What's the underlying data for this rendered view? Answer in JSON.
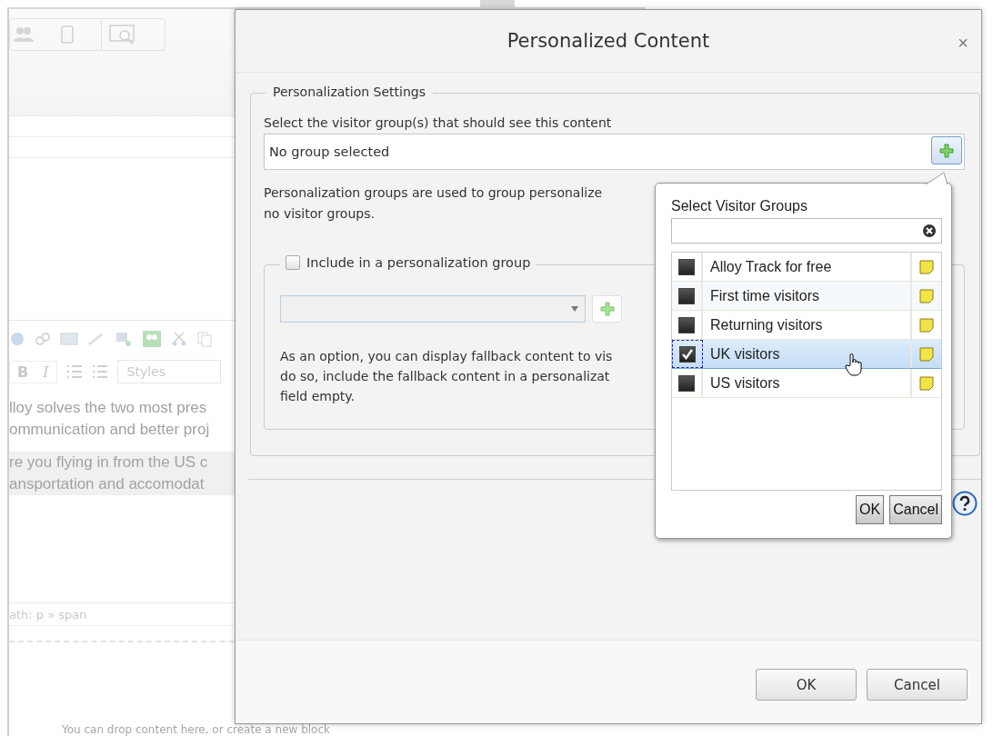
{
  "editor": {
    "format_buttons": [
      "B",
      "I"
    ],
    "styles_dropdown": "Styles",
    "paragraphs": [
      {
        "lines": [
          "lloy solves the two most pres",
          "ommunication and better proj"
        ],
        "highlighted": false
      },
      {
        "lines": [
          "re you flying in from the US c",
          "ansportation and accomodat"
        ],
        "highlighted": true
      }
    ],
    "path": "ath: p » span",
    "drop_hint": "You can drop content here, or create a new block"
  },
  "dialog": {
    "title": "Personalized Content",
    "close": "×",
    "legend": "Personalization Settings",
    "group_label": "Select the visitor group(s) that should see this content",
    "group_value": "No group selected",
    "description_lines": [
      "Personalization groups are used to group personalize",
      "no visitor groups."
    ],
    "include": {
      "label": "Include in a personalization group",
      "checked": false
    },
    "fallback_lines": [
      "As an option, you can display fallback content to vis",
      "do so, include the fallback content in a personalizat",
      "field empty."
    ],
    "buttons": [
      "OK",
      "Cancel"
    ]
  },
  "popup": {
    "title": "Select Visitor Groups",
    "groups": [
      {
        "name": "Alloy Track for free",
        "checked": false,
        "selected": false
      },
      {
        "name": "First time visitors",
        "checked": false,
        "selected": false
      },
      {
        "name": "Returning visitors",
        "checked": false,
        "selected": false
      },
      {
        "name": "UK visitors",
        "checked": true,
        "selected": true
      },
      {
        "name": "US visitors",
        "checked": false,
        "selected": false
      }
    ],
    "buttons": [
      "OK",
      "Cancel"
    ]
  }
}
